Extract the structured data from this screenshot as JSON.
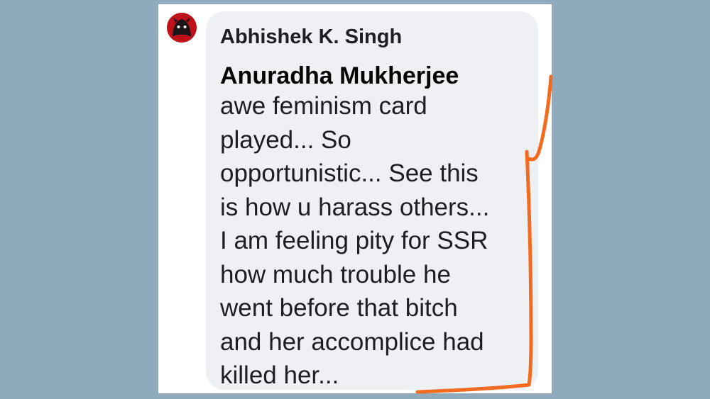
{
  "comment": {
    "author_name": "Abhishek K. Singh",
    "mention_name": "Anuradha Mukherjee",
    "text": "awe feminism card\nplayed... So\nopportunistic... See this\nis how u harass others...\nI am feeling pity for SSR\nhow much trouble he\nwent before that bitch\nand her accomplice had\nkilled her..."
  },
  "colors": {
    "background": "#8fa9bd",
    "bubble": "#eef0f3",
    "annotation": "#f26b21",
    "avatar": "#c0101a"
  },
  "icons": {
    "avatar": "profile-avatar-icon"
  }
}
